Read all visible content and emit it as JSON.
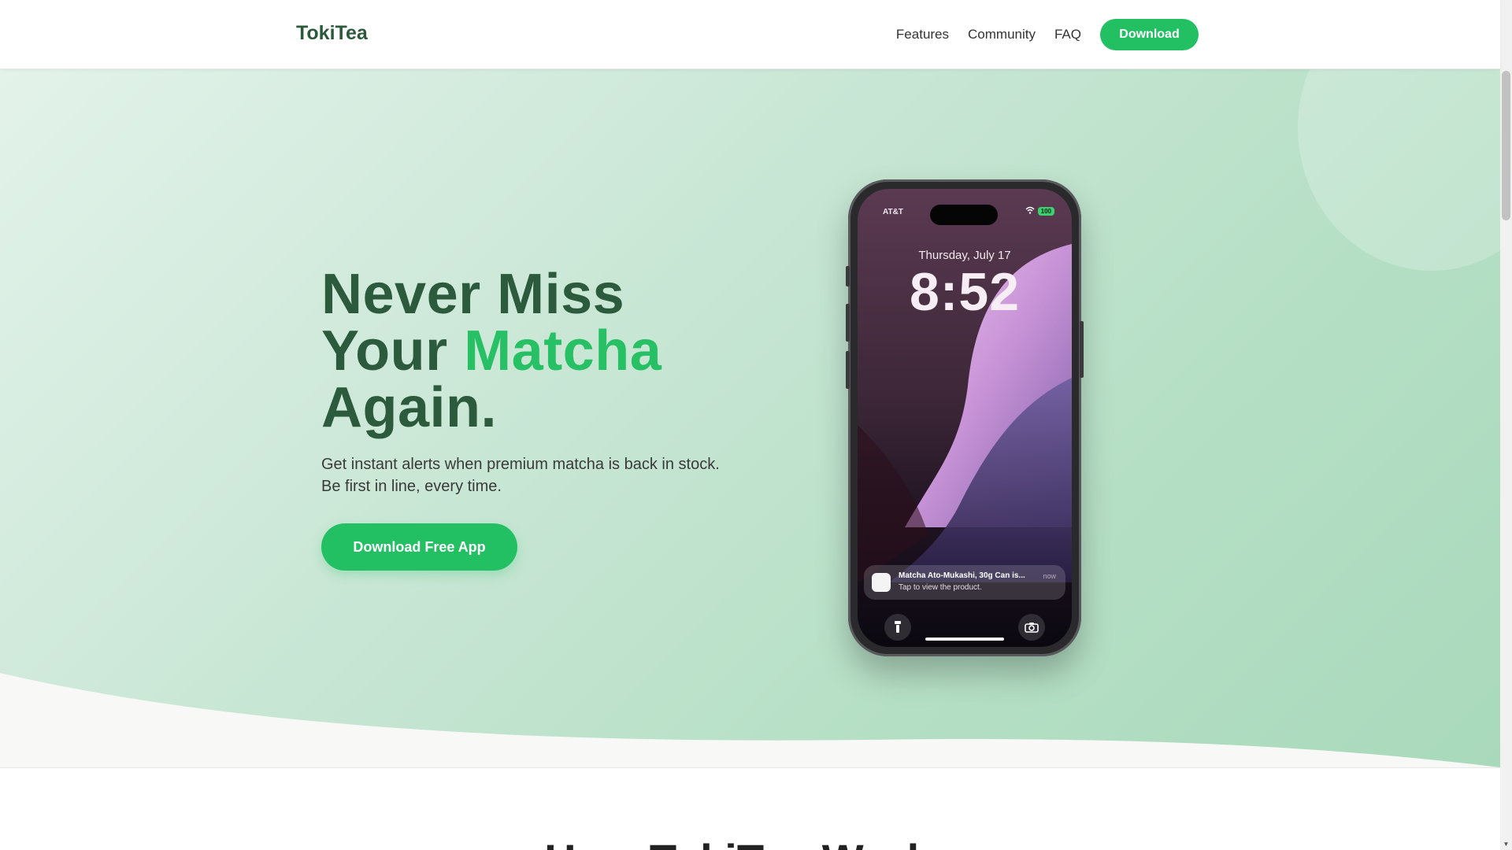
{
  "nav": {
    "logo": "TokiTea",
    "links": [
      "Features",
      "Community",
      "FAQ"
    ],
    "download_label": "Download"
  },
  "hero": {
    "headline_line1": "Never Miss",
    "headline_line2_prefix": "Your ",
    "headline_line2_accent": "Matcha",
    "headline_line3": "Again.",
    "subtext_line1": "Get instant alerts when premium matcha is back in stock.",
    "subtext_line2": "Be first in line, every time.",
    "cta_label": "Download Free App"
  },
  "phone": {
    "carrier": "AT&T",
    "battery": "100",
    "date": "Thursday, July 17",
    "time": "8:52",
    "notification": {
      "title": "Matcha Ato-Mukashi, 30g Can is...",
      "body": "Tap to view the product.",
      "time": "now"
    },
    "flashlight_icon": "flashlight-icon",
    "camera_icon": "camera-icon"
  },
  "section": {
    "title": "How TokiTea Works"
  },
  "colors": {
    "brand_green": "#22c063",
    "dark_green": "#2c5a3c",
    "accent_green": "#27c065"
  }
}
